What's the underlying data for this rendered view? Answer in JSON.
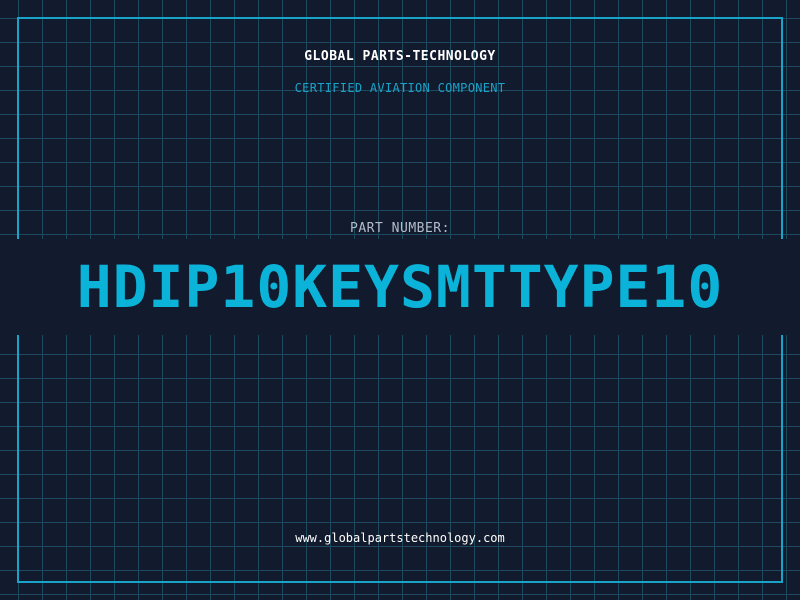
{
  "company": "GLOBAL PARTS-TECHNOLOGY",
  "subtitle": "CERTIFIED AVIATION COMPONENT",
  "part_number_label": "PART NUMBER:",
  "part_number": "HDIP10KEYSMTTYPE10",
  "website": "www.globalpartstechnology.com",
  "colors": {
    "background": "#121a2e",
    "grid": "#1d4a5e",
    "accent": "#1aa3c9",
    "part_number": "#0bb3d9",
    "title": "#ffffff",
    "label": "#b3bcc9"
  }
}
